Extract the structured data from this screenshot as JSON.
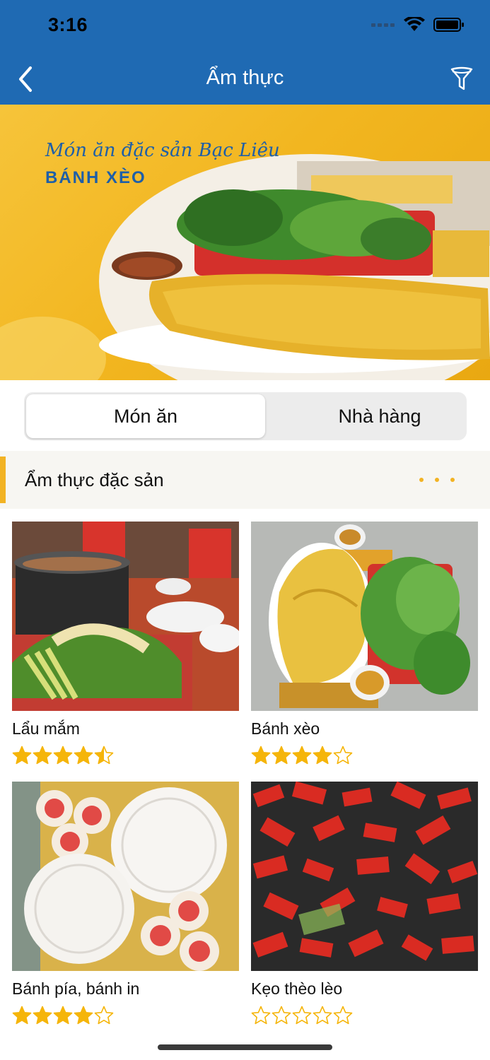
{
  "status_bar": {
    "time": "3:16"
  },
  "nav": {
    "title": "Ẩm thực"
  },
  "banner": {
    "subtitle": "Món ăn đặc sản Bạc Liêu",
    "title": "BÁNH XÈO"
  },
  "tabs": [
    {
      "label": "Món ăn",
      "selected": true
    },
    {
      "label": "Nhà hàng",
      "selected": false
    }
  ],
  "section": {
    "title": "Ẩm thực đặc sản"
  },
  "items": [
    {
      "name": "Lẩu mắm",
      "rating": 4.5
    },
    {
      "name": "Bánh xèo",
      "rating": 4
    },
    {
      "name": "Bánh pía, bánh in",
      "rating": 4
    },
    {
      "name": "Kẹo thèo lèo",
      "rating": 0
    }
  ],
  "colors": {
    "primary": "#1f6ab3",
    "accent": "#f2b324",
    "star": "#f5b50a"
  }
}
